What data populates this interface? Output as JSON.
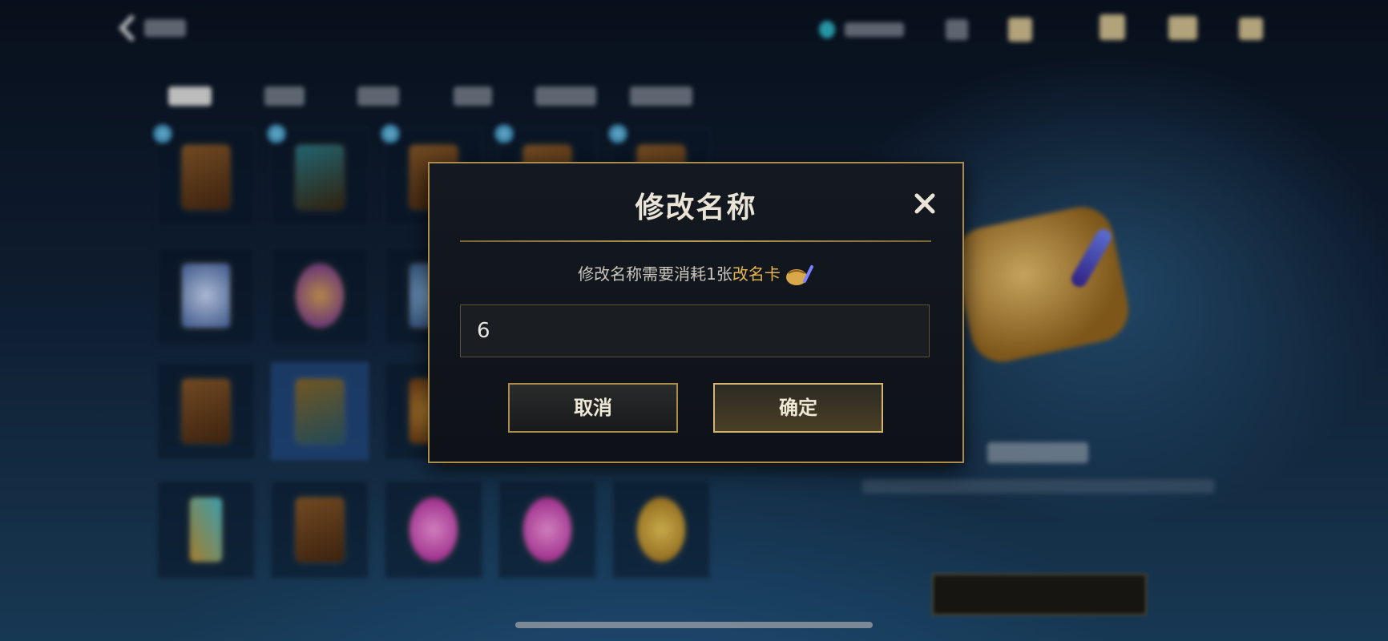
{
  "dialog": {
    "title": "修改名称",
    "message_prefix": "修改名称需要消耗1张",
    "message_highlight": "改名卡",
    "input_value": "6",
    "cancel_label": "取消",
    "confirm_label": "确定"
  },
  "colors": {
    "accent_gold": "#a98b4e",
    "highlight": "#e6b54e",
    "dialog_bg": "#141820"
  },
  "icons": [
    "back-chevron-icon",
    "close-icon",
    "rename-card-icon"
  ]
}
